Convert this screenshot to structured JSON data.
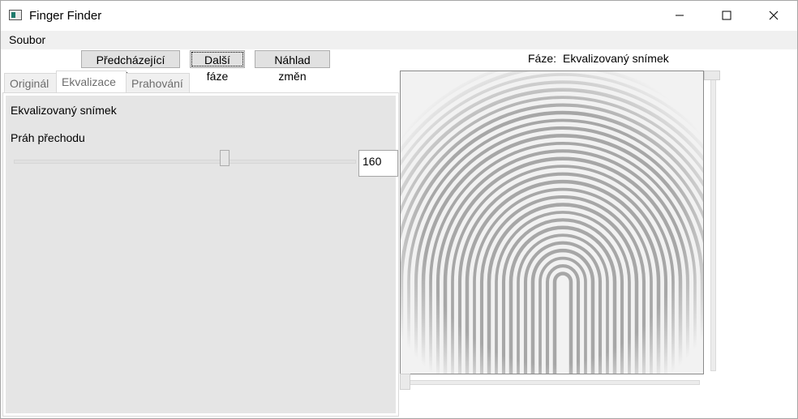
{
  "window": {
    "title": "Finger Finder"
  },
  "menu": {
    "items": [
      {
        "label": "Soubor"
      }
    ]
  },
  "toolbar": {
    "prev_label": "Předcházející fáze",
    "next_label": "Další fáze",
    "preview_label": "Náhlad změn"
  },
  "phase": {
    "label": "Fáze:",
    "value": "Ekvalizovaný snímek"
  },
  "tabs": [
    {
      "label": "Originál",
      "active": false
    },
    {
      "label": "Ekvalizace",
      "active": true
    },
    {
      "label": "Prahování",
      "active": false
    }
  ],
  "panel": {
    "heading": "Ekvalizovaný snímek",
    "threshold_label": "Práh přechodu",
    "threshold_value": "160"
  },
  "slider": {
    "value": 160,
    "min": 0,
    "max": 255
  },
  "colors": {
    "accent": "#1e7a6c",
    "panel_bg": "#e5e5e5",
    "ridge": "#9a9a9a"
  }
}
